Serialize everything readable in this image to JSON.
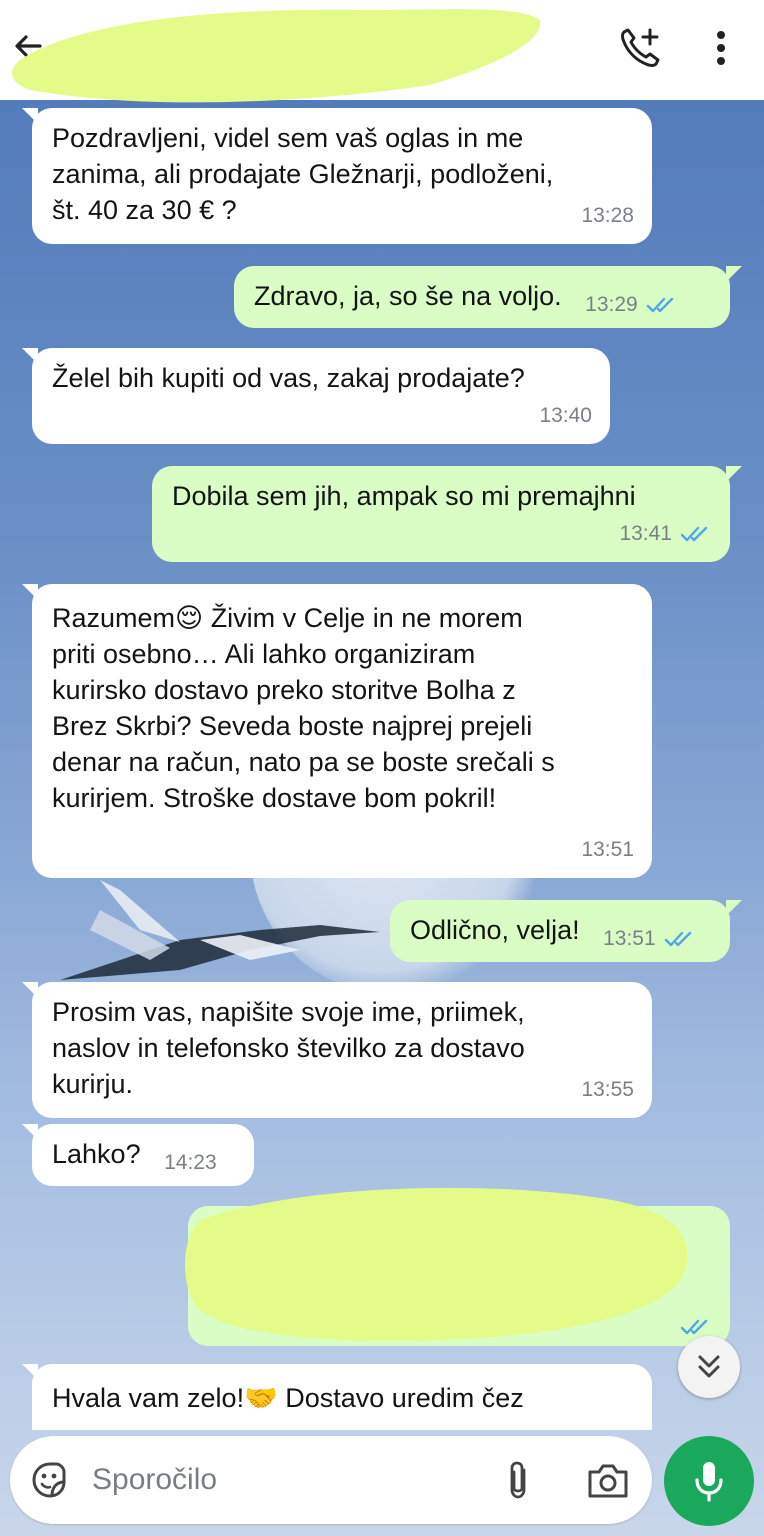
{
  "header": {
    "back_icon": "arrow-left-icon",
    "contact_name": "",
    "call_icon": "add-call-icon",
    "menu_icon": "more-vertical-icon"
  },
  "messages": [
    {
      "direction": "in",
      "text": "Pozdravljeni, videl sem vaš oglas in me\nzanima, ali prodajate Gležnarji, podloženi,\nšt. 40 za 30 € ?",
      "time": "13:28"
    },
    {
      "direction": "out",
      "text": "Zdravo, ja, so še na voljo.",
      "time": "13:29",
      "status": "read"
    },
    {
      "direction": "in",
      "text": "Želel bih kupiti od vas, zakaj prodajate?",
      "time": "13:40"
    },
    {
      "direction": "out",
      "text": "Dobila sem jih, ampak so mi premajhni",
      "time": "13:41",
      "status": "read"
    },
    {
      "direction": "in",
      "text_before_emoji": "Razumem",
      "emoji": "😌",
      "text": " Živim v Celje in ne morem\npriti osebno… Ali lahko organiziram\nkurirsko dostavo preko storitve Bolha z\nBrez Skrbi? Seveda boste najprej prejeli\ndenar na račun, nato pa se boste srečali s\nkurirjem. Stroške dostave bom pokril!",
      "time": "13:51"
    },
    {
      "direction": "out",
      "text": "Odlično, velja!",
      "time": "13:51",
      "status": "read"
    },
    {
      "direction": "in",
      "text": "Prosim vas, napišite svoje ime, priimek,\nnaslov in telefonsko številko za dostavo\nkurirju.",
      "time": "13:55"
    },
    {
      "direction": "in",
      "text": "Lahko?",
      "time": "14:23"
    },
    {
      "direction": "out",
      "text": "",
      "time": "",
      "status": "read",
      "redacted": true
    },
    {
      "direction": "in",
      "text_before_emoji": "Hvala vam zelo!",
      "emoji": "🤝",
      "text": " Dostavo uredim čez",
      "time": ""
    }
  ],
  "scroll_icon": "double-chevron-down-icon",
  "composer": {
    "placeholder": "Sporočilo",
    "sticker_icon": "sticker-icon",
    "attach_icon": "paperclip-icon",
    "camera_icon": "camera-icon",
    "mic_icon": "microphone-icon"
  },
  "colors": {
    "incoming_bubble": "#ffffff",
    "outgoing_bubble": "#dafdc5",
    "read_ticks": "#4fa6ec",
    "mic_button": "#1aa85c",
    "redaction_highlight": "#e4fb8a"
  }
}
